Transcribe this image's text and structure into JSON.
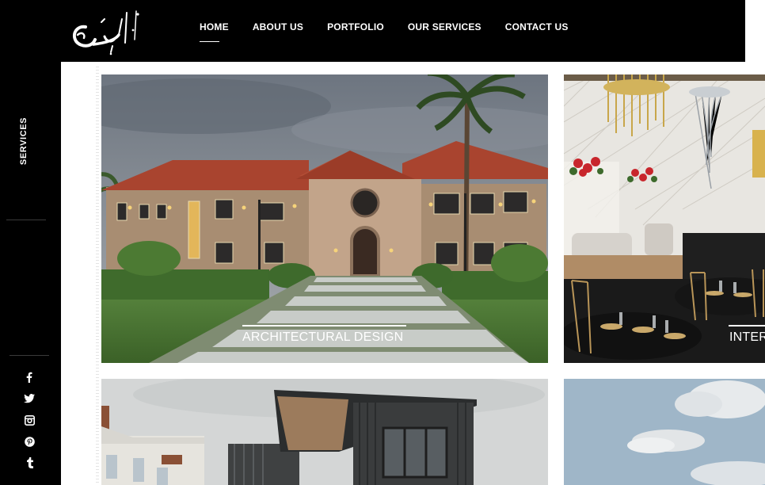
{
  "header": {
    "nav": [
      {
        "label": "HOME",
        "active": true
      },
      {
        "label": "ABOUT US",
        "active": false
      },
      {
        "label": "PORTFOLIO",
        "active": false
      },
      {
        "label": "OUR SERVICES",
        "active": false
      },
      {
        "label": "CONTACT US",
        "active": false
      }
    ]
  },
  "sidebar": {
    "section_label": "SERVICES",
    "social_icons": [
      "facebook-icon",
      "twitter-icon",
      "instagram-icon",
      "pinterest-icon",
      "tumblr-icon"
    ]
  },
  "tiles": [
    {
      "caption": "ARCHITECTURAL DESIGN"
    },
    {
      "caption": "INTER"
    }
  ],
  "colors": {
    "header_bg": "#000000",
    "roof": "#a9442f",
    "wall": "#b89a7c",
    "lawn": "#4d7a35"
  }
}
